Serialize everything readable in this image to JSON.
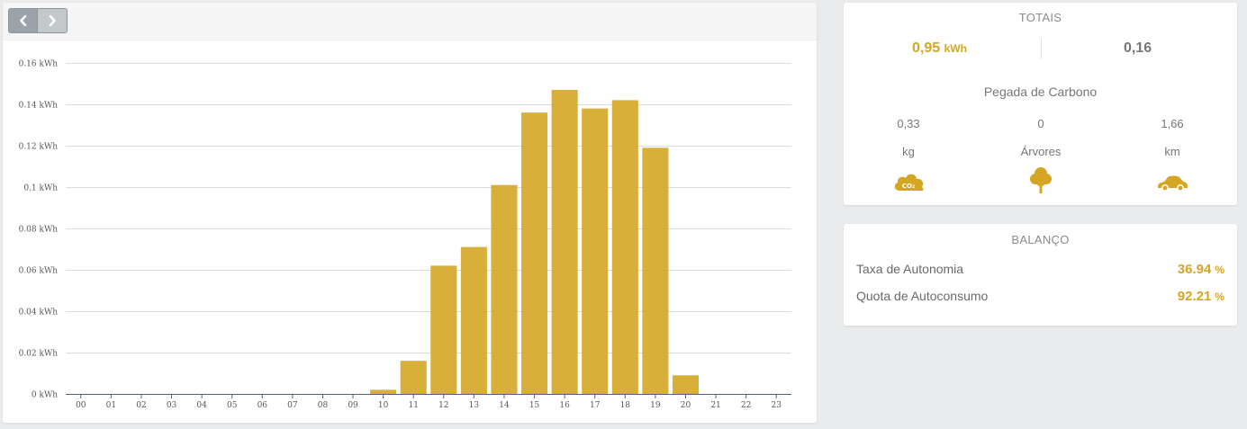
{
  "nav": {
    "prev_icon": "chevron-left-icon",
    "next_icon": "chevron-right-icon"
  },
  "chart_data": {
    "type": "bar",
    "categories": [
      "00",
      "01",
      "02",
      "03",
      "04",
      "05",
      "06",
      "07",
      "08",
      "09",
      "10",
      "11",
      "12",
      "13",
      "14",
      "15",
      "16",
      "17",
      "18",
      "19",
      "20",
      "21",
      "22",
      "23"
    ],
    "series": [
      {
        "values": [
          0,
          0,
          0,
          0,
          0,
          0,
          0,
          0,
          0,
          0,
          0.002,
          0.016,
          0.062,
          0.071,
          0.101,
          0.136,
          0.147,
          0.138,
          0.142,
          0.119,
          0.009,
          0,
          0,
          0
        ]
      }
    ],
    "ylim": [
      0,
      0.16
    ],
    "y_ticks": [
      0,
      0.02,
      0.04,
      0.06,
      0.08,
      0.1,
      0.12,
      0.14,
      0.16
    ],
    "y_tick_labels": [
      "0 kWh",
      "0.02 kWh",
      "0.04 kWh",
      "0.06 kWh",
      "0.08 kWh",
      "0.1 kWh",
      "0.12 kWh",
      "0.14 kWh",
      "0.16 kWh"
    ],
    "bar_color": "#d4a624",
    "grid": true
  },
  "totals": {
    "title": "TOTAIS",
    "energy_value": "0,95",
    "energy_unit": "kWh",
    "secondary_value": "0,16",
    "carbon_title": "Pegada de Carbono",
    "co2_value": "0,33",
    "co2_unit": "kg",
    "trees_value": "0",
    "trees_unit": "Árvores",
    "distance_value": "1,66",
    "distance_unit": "km",
    "co2_icon_text": "CO₂",
    "accent_color": "#d4a624"
  },
  "balance": {
    "title": "BALANÇO",
    "autonomy_label": "Taxa de Autonomia",
    "autonomy_value": "36.94",
    "autonomy_unit": "%",
    "selfconsumption_label": "Quota de Autoconsumo",
    "selfconsumption_value": "92.21",
    "selfconsumption_unit": "%"
  }
}
